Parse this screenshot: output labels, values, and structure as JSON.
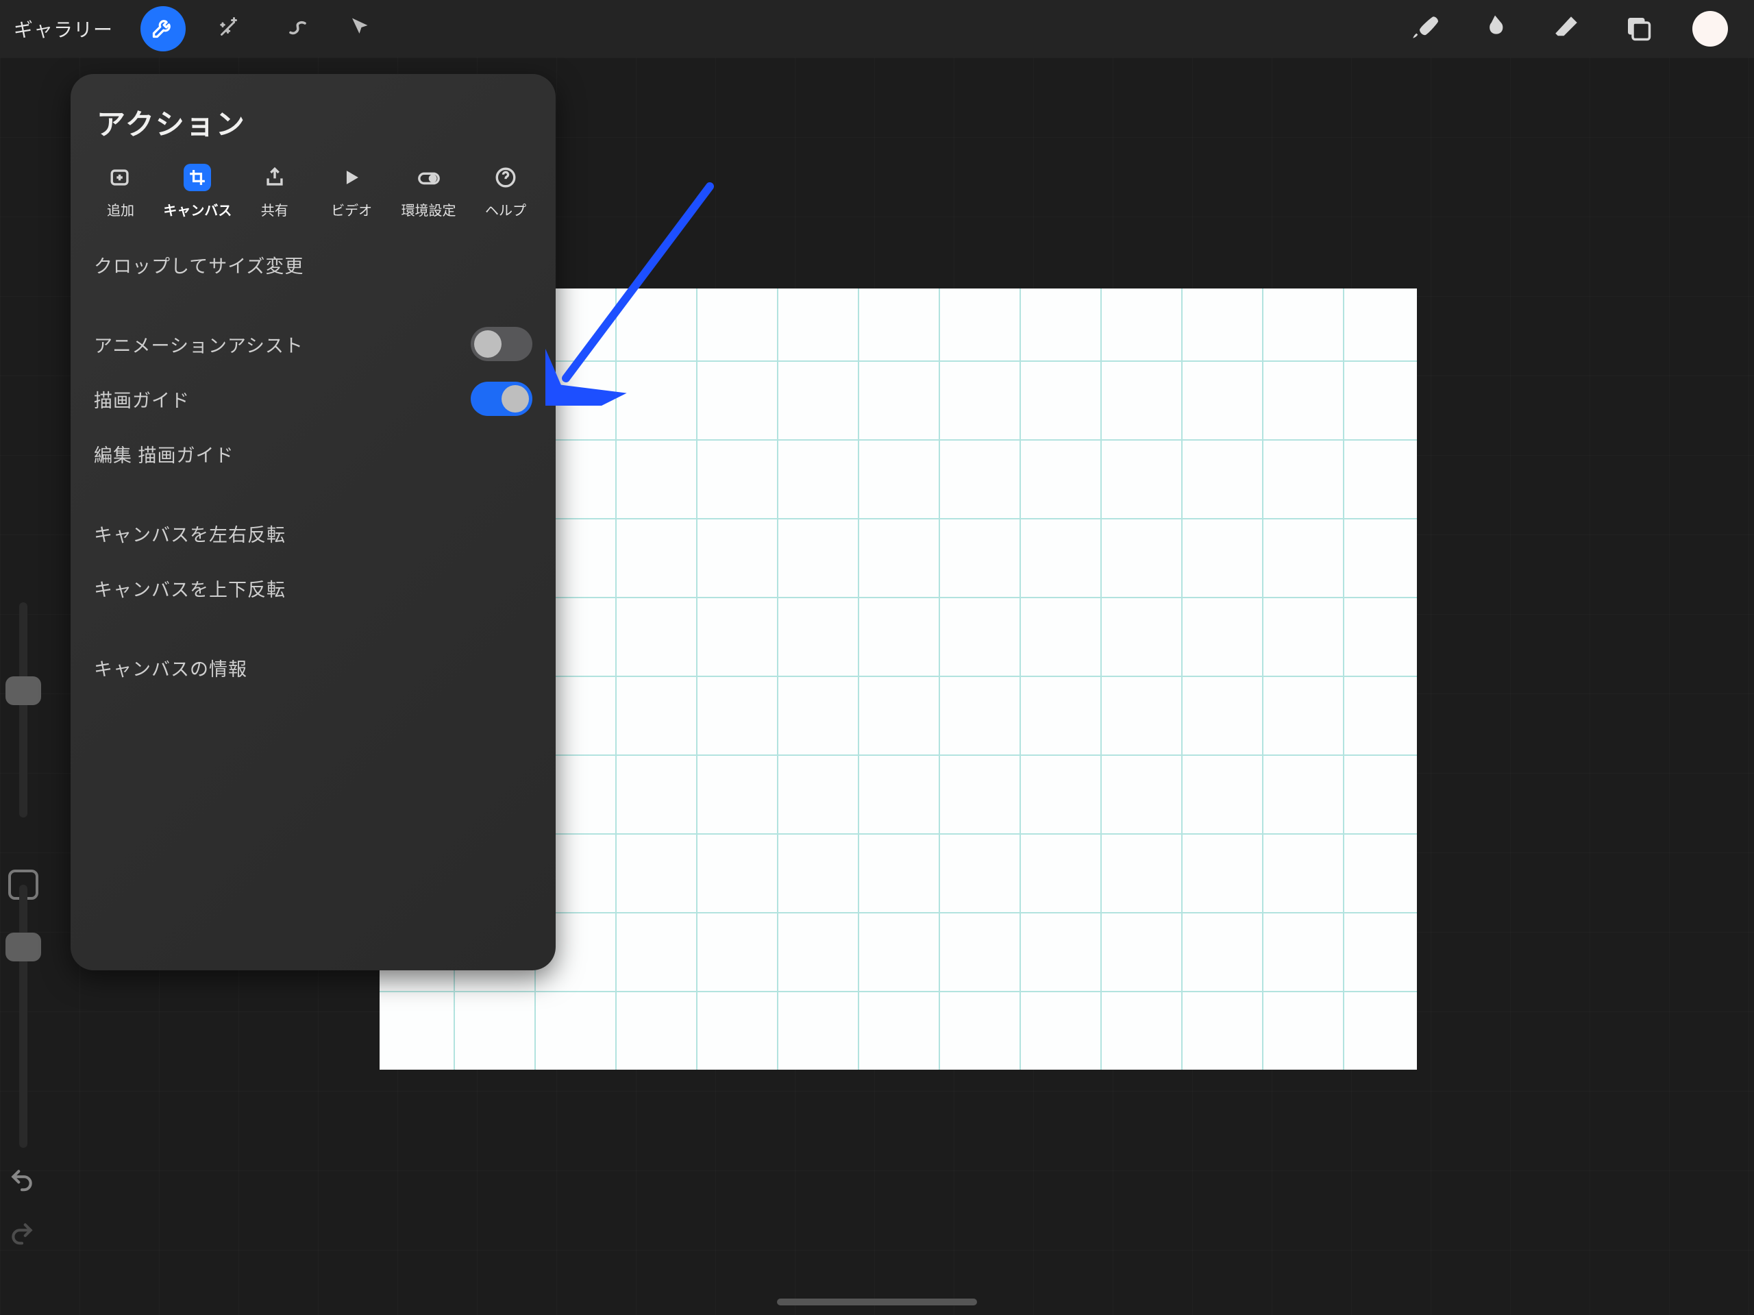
{
  "topbar": {
    "gallery": "ギャラリー",
    "left_icons": [
      "wrench-icon",
      "magic-wand-icon",
      "s-path-icon",
      "cursor-icon"
    ],
    "right_icons": [
      "brush-icon",
      "smudge-icon",
      "eraser-icon",
      "layers-icon"
    ],
    "active_left_icon": "wrench-icon"
  },
  "actions": {
    "title": "アクション",
    "tabs": {
      "add": {
        "label": "追加",
        "icon": "add-image-icon"
      },
      "canvas": {
        "label": "キャンバス",
        "icon": "crop-icon",
        "active": true
      },
      "share": {
        "label": "共有",
        "icon": "share-up-icon"
      },
      "video": {
        "label": "ビデオ",
        "icon": "play-icon"
      },
      "prefs": {
        "label": "環境設定",
        "icon": "switch-icon"
      },
      "help": {
        "label": "ヘルプ",
        "icon": "question-icon"
      }
    },
    "rows": {
      "crop_resize": "クロップしてサイズ変更",
      "anim_assist": "アニメーションアシスト",
      "draw_guide": "描画ガイド",
      "edit_draw_guide": "編集 描画ガイド",
      "flip_h": "キャンバスを左右反転",
      "flip_v": "キャンバスを上下反転",
      "canvas_info": "キャンバスの情報"
    },
    "toggles": {
      "anim_assist": false,
      "draw_guide": true
    }
  },
  "annotation": {
    "arrow_target": "draw-guide-toggle"
  },
  "colors": {
    "accent": "#1f74ff",
    "grid": "#b2e3df"
  }
}
